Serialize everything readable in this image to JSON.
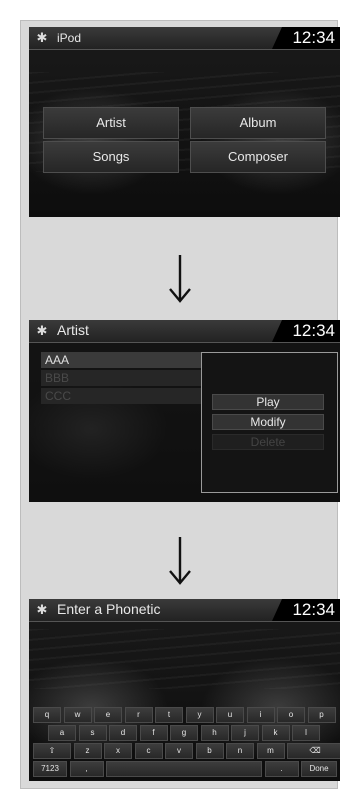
{
  "screen1": {
    "title": "iPod",
    "clock": "12:34",
    "buttons": [
      "Artist",
      "Album",
      "Songs",
      "Composer"
    ]
  },
  "screen2": {
    "title": "Artist",
    "clock": "12:34",
    "list": [
      "AAA",
      "BBB",
      "CCC"
    ],
    "popup": [
      "Play",
      "Modify",
      "Delete"
    ]
  },
  "screen3": {
    "title": "Enter a Phonetic",
    "clock": "12:34",
    "keyboard": {
      "row1": [
        "q",
        "w",
        "e",
        "r",
        "t",
        "y",
        "u",
        "i",
        "o",
        "p"
      ],
      "row2": [
        "a",
        "s",
        "d",
        "f",
        "g",
        "h",
        "j",
        "k",
        "l"
      ],
      "row3_shift": "⇧",
      "row3": [
        "z",
        "x",
        "c",
        "v",
        "b",
        "n",
        "m"
      ],
      "row3_backspace": "⌫",
      "row4": [
        "7123",
        ",",
        "",
        ".",
        "Done"
      ]
    }
  },
  "icons": {
    "gear": "gear-icon",
    "arrow": "arrow-down-icon"
  },
  "colors": {
    "panel": "#d9d9d9",
    "screen": "#111111",
    "button": "#333333"
  }
}
